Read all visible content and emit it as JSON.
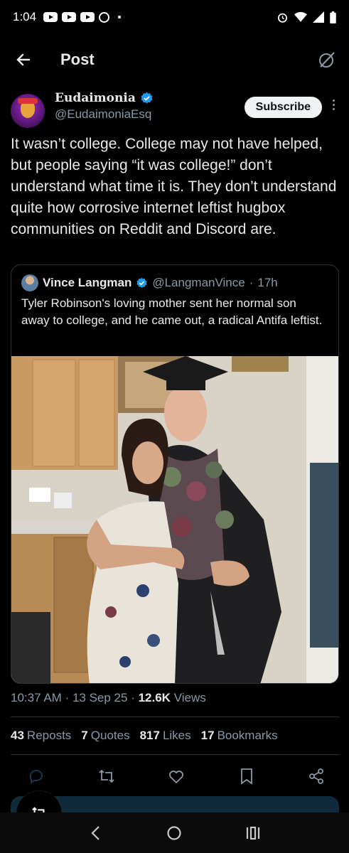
{
  "status_bar": {
    "time": "1:04",
    "left_icons": [
      "youtube-icon",
      "youtube-icon",
      "youtube-icon",
      "alarm-icon",
      "dot-icon"
    ],
    "right_icons": [
      "alarm-icon",
      "wifi-icon",
      "signal-icon",
      "battery-icon"
    ]
  },
  "app_bar": {
    "title": "Post",
    "back_icon": "arrow-left-icon",
    "grok_icon": "grok-icon"
  },
  "tweet": {
    "author_name": "Eudaimonia",
    "author_handle": "@EudaimoniaEsq",
    "subscribe_label": "Subscribe",
    "text": "It wasn’t college. College may not have helped, but people saying “it was college!” don’t understand what time it is. They don’t understand quite how corrosive internet leftist hugbox communities on Reddit and Discord are.",
    "quote": {
      "author_name": "Vince Langman",
      "author_handle": "@LangmanVince",
      "separator": "·",
      "age": "17h",
      "text": "Tyler Robinson's loving mother sent her normal son away to college, and he came out, a radical Antifa leftist."
    },
    "time": "10:37 AM",
    "date": "13 Sep 25",
    "views_count": "12.6K",
    "views_label": "Views",
    "stats": [
      {
        "count": "43",
        "label": "Reposts"
      },
      {
        "count": "7",
        "label": "Quotes"
      },
      {
        "count": "817",
        "label": "Likes"
      },
      {
        "count": "17",
        "label": "Bookmarks"
      }
    ]
  },
  "actions": [
    "reply-icon",
    "retweet-icon",
    "like-icon",
    "bookmark-icon",
    "share-icon"
  ],
  "fab_icon": "repost-fab-icon",
  "nav": [
    "back-nav-icon",
    "home-nav-icon",
    "recents-nav-icon"
  ],
  "colors": {
    "background": "#000000",
    "text": "#e7e9ea",
    "muted": "#8b98a5",
    "verified_blue": "#1d9bf0",
    "border": "#2f3336"
  }
}
